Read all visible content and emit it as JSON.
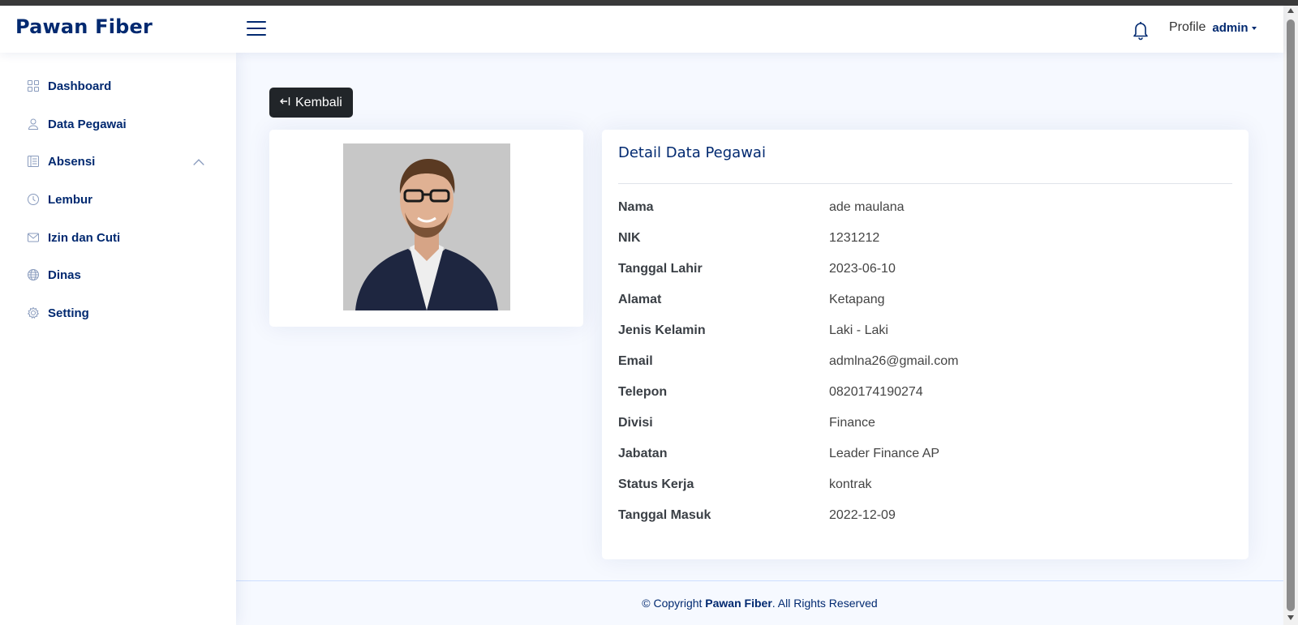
{
  "brand": "Pawan Fiber",
  "header": {
    "profile_alt": "Profile",
    "user_name": "admin"
  },
  "sidebar": {
    "items": [
      {
        "label": "Dashboard",
        "icon": "grid-icon"
      },
      {
        "label": "Data Pegawai",
        "icon": "person-icon"
      },
      {
        "label": "Absensi",
        "icon": "layout-text-sidebar-icon",
        "expanded": true
      },
      {
        "label": "Lembur",
        "icon": "clock-icon"
      },
      {
        "label": "Izin dan Cuti",
        "icon": "envelope-icon"
      },
      {
        "label": "Dinas",
        "icon": "globe-icon"
      },
      {
        "label": "Setting",
        "icon": "gear-icon"
      }
    ]
  },
  "main": {
    "back_button": "Kembali",
    "detail_title": "Detail Data Pegawai",
    "fields": [
      {
        "label": "Nama",
        "value": "ade maulana"
      },
      {
        "label": "NIK",
        "value": "1231212"
      },
      {
        "label": "Tanggal Lahir",
        "value": "2023-06-10"
      },
      {
        "label": "Alamat",
        "value": "Ketapang"
      },
      {
        "label": "Jenis Kelamin",
        "value": "Laki - Laki"
      },
      {
        "label": "Email",
        "value": "admlna26@gmail.com"
      },
      {
        "label": "Telepon",
        "value": "0820174190274"
      },
      {
        "label": "Divisi",
        "value": "Finance"
      },
      {
        "label": "Jabatan",
        "value": "Leader Finance AP"
      },
      {
        "label": "Status Kerja",
        "value": "kontrak"
      },
      {
        "label": "Tanggal Masuk",
        "value": "2022-12-09"
      }
    ]
  },
  "footer": {
    "prefix": "© Copyright ",
    "brand": "Pawan Fiber",
    "suffix": ". All Rights Reserved"
  },
  "colors": {
    "primary": "#012970",
    "background": "#f6f9ff",
    "button_dark": "#212529"
  }
}
